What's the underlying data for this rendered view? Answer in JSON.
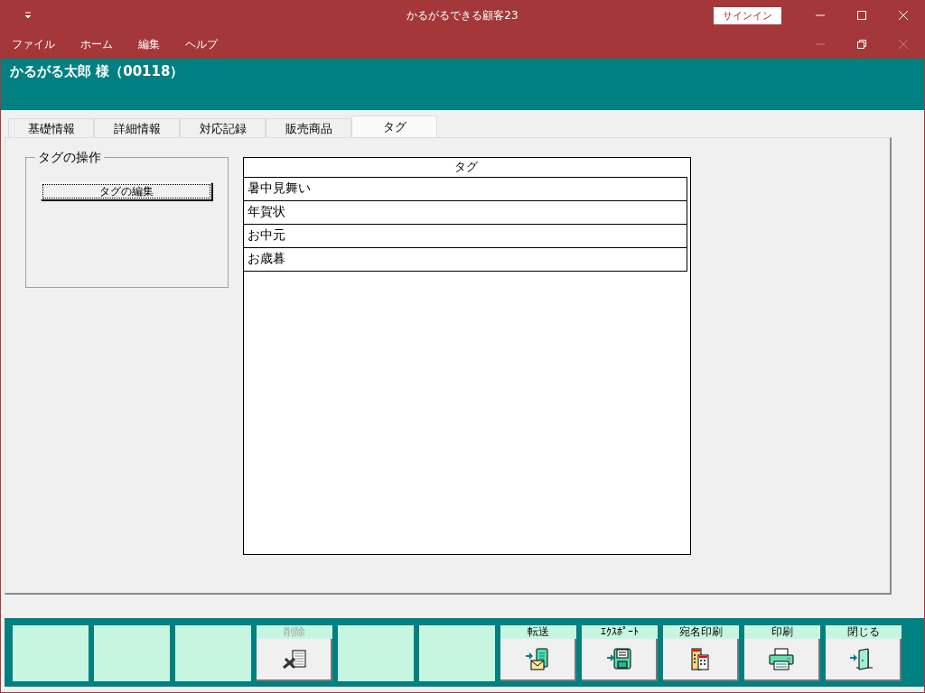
{
  "window": {
    "title": "かるがるできる顧客23",
    "sign_in": "サインイン"
  },
  "menu": [
    {
      "label": "ファイル"
    },
    {
      "label": "ホーム"
    },
    {
      "label": "編集"
    },
    {
      "label": "ヘルプ"
    }
  ],
  "header": {
    "customer": "かるがる太郎 様（00118）"
  },
  "tabs": [
    {
      "label": "基礎情報",
      "selected": false
    },
    {
      "label": "詳細情報",
      "selected": false
    },
    {
      "label": "対応記録",
      "selected": false
    },
    {
      "label": "販売商品",
      "selected": false
    },
    {
      "label": "タグ",
      "selected": true
    }
  ],
  "tag_group": {
    "legend": "タグの操作",
    "button": "タグの編集"
  },
  "table": {
    "columns": [
      "タグ"
    ],
    "rows": [
      "暑中見舞い",
      "年賀状",
      "お中元",
      "お歳暮"
    ]
  },
  "footer_buttons": [
    {
      "kind": "empty"
    },
    {
      "kind": "empty"
    },
    {
      "kind": "empty"
    },
    {
      "kind": "button",
      "label": "削除",
      "disabled": true
    },
    {
      "kind": "empty"
    },
    {
      "kind": "empty"
    },
    {
      "kind": "button",
      "label": "転送",
      "disabled": false
    },
    {
      "kind": "button",
      "label": "ｴｸｽﾎﾟｰﾄ",
      "disabled": false
    },
    {
      "kind": "button",
      "label": "宛名印刷",
      "disabled": false
    },
    {
      "kind": "button",
      "label": "印刷",
      "disabled": false
    },
    {
      "kind": "button",
      "label": "閉じる",
      "disabled": false
    }
  ]
}
